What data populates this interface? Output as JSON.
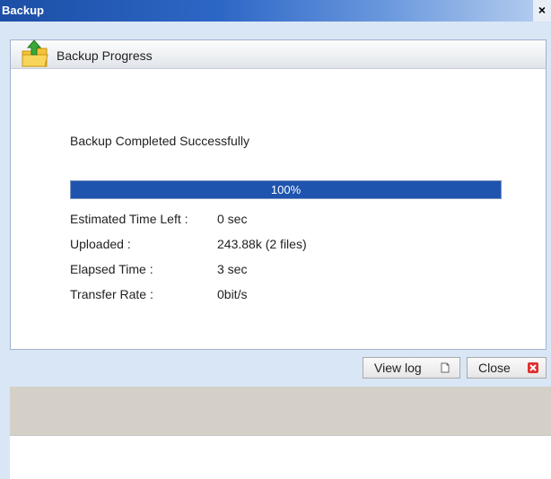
{
  "window": {
    "title": "Backup",
    "close_glyph": "×"
  },
  "panel": {
    "header_title": "Backup Progress",
    "header_icon": "folder-upload-icon",
    "status_text": "Backup Completed Successfully"
  },
  "progress": {
    "percent": 100,
    "label": "100%",
    "color": "#1f54ae"
  },
  "stats": [
    {
      "label": "Estimated Time Left :",
      "value": "0 sec"
    },
    {
      "label": "Uploaded :",
      "value": "243.88k (2 files)"
    },
    {
      "label": "Elapsed Time :",
      "value": "3 sec"
    },
    {
      "label": "Transfer Rate :",
      "value": "0bit/s"
    }
  ],
  "buttons": {
    "view_log": {
      "label": "View log",
      "icon": "document-icon"
    },
    "close": {
      "label": "Close",
      "icon": "close-x-icon",
      "icon_color": "#e03030"
    }
  }
}
